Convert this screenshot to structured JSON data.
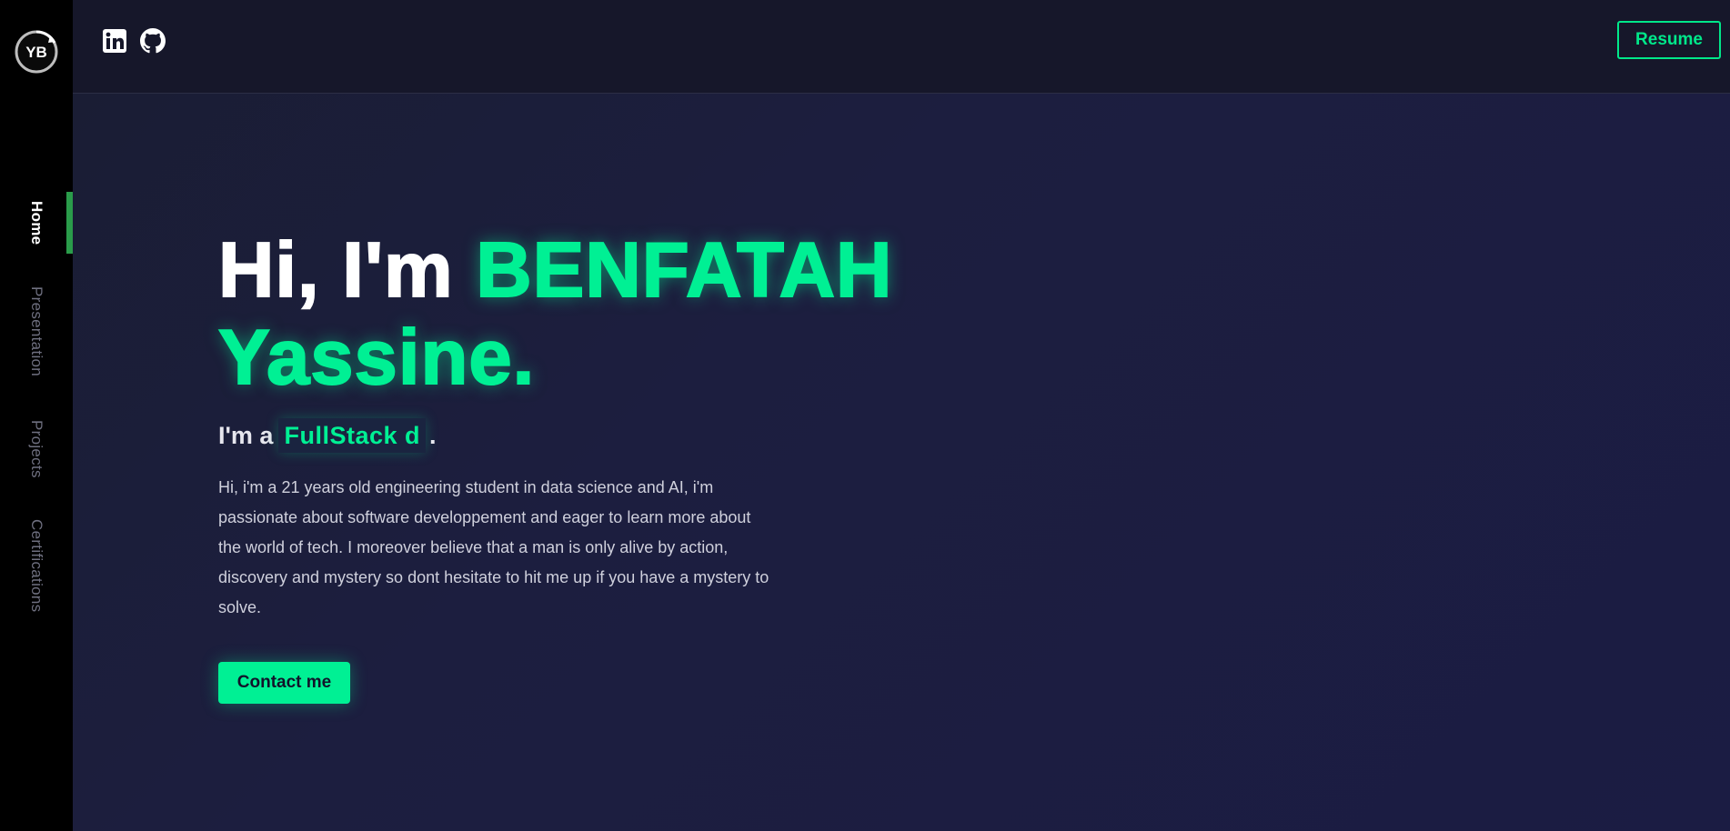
{
  "sidebar": {
    "logo_text": "YB",
    "nav": [
      {
        "label": "Home",
        "active": true
      },
      {
        "label": "Presentation",
        "active": false
      },
      {
        "label": "Projects",
        "active": false
      },
      {
        "label": "Certifications",
        "active": false
      }
    ]
  },
  "header": {
    "social_icons": [
      "linkedin-icon",
      "github-icon"
    ],
    "resume_label": "Resume"
  },
  "hero": {
    "greeting": "Hi, I'm ",
    "name_first": "BENFATAH",
    "name_last": "Yassine.",
    "role_prefix": "I'm a",
    "role_typed": "FullStack d",
    "role_suffix": ".",
    "bio": "Hi, i'm a 21 years old engineering student in data science and AI, i'm passionate about software developpement and eager to learn more about the world of tech. I moreover believe that a man is only alive by action, discovery and mystery so dont hesitate to hit me up if you have a mystery to solve.",
    "contact_label": "Contact me"
  },
  "colors": {
    "accent": "#00f094",
    "sidebar_bg": "#000000",
    "main_bg": "#1c1e3f"
  }
}
